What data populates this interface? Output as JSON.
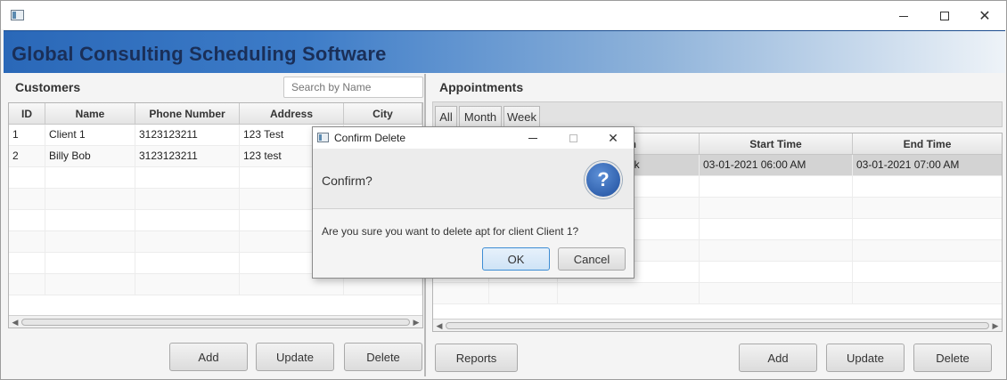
{
  "window": {
    "title": "",
    "controls": {
      "minimize": "—",
      "maximize": "☐",
      "close": "✕"
    }
  },
  "banner": {
    "title": "Global Consulting Scheduling Software"
  },
  "customers": {
    "title": "Customers",
    "search_placeholder": "Search by Name",
    "columns": [
      "ID",
      "Name",
      "Phone Number",
      "Address",
      "City"
    ],
    "rows": [
      [
        "1",
        "Client 1",
        "3123123211",
        "123 Test",
        ""
      ],
      [
        "2",
        "Billy Bob",
        "3123123211",
        "123 test",
        ""
      ]
    ],
    "buttons": {
      "add": "Add",
      "update": "Update",
      "delete": "Delete"
    }
  },
  "appointments": {
    "title": "Appointments",
    "tabs": [
      "All",
      "Month",
      "Week"
    ],
    "columns": [
      "",
      "",
      "ion",
      "Start Time",
      "End Time"
    ],
    "rows": [
      [
        "",
        "",
        "ork",
        "03-01-2021 06:00 AM",
        "03-01-2021 07:00 AM"
      ]
    ],
    "buttons": {
      "reports": "Reports",
      "add": "Add",
      "update": "Update",
      "delete": "Delete"
    }
  },
  "dialog": {
    "title": "Confirm Delete",
    "header": "Confirm?",
    "icon": "question-icon",
    "icon_glyph": "?",
    "message": "Are you sure you want to delete apt for client Client 1?",
    "ok": "OK",
    "cancel": "Cancel"
  }
}
